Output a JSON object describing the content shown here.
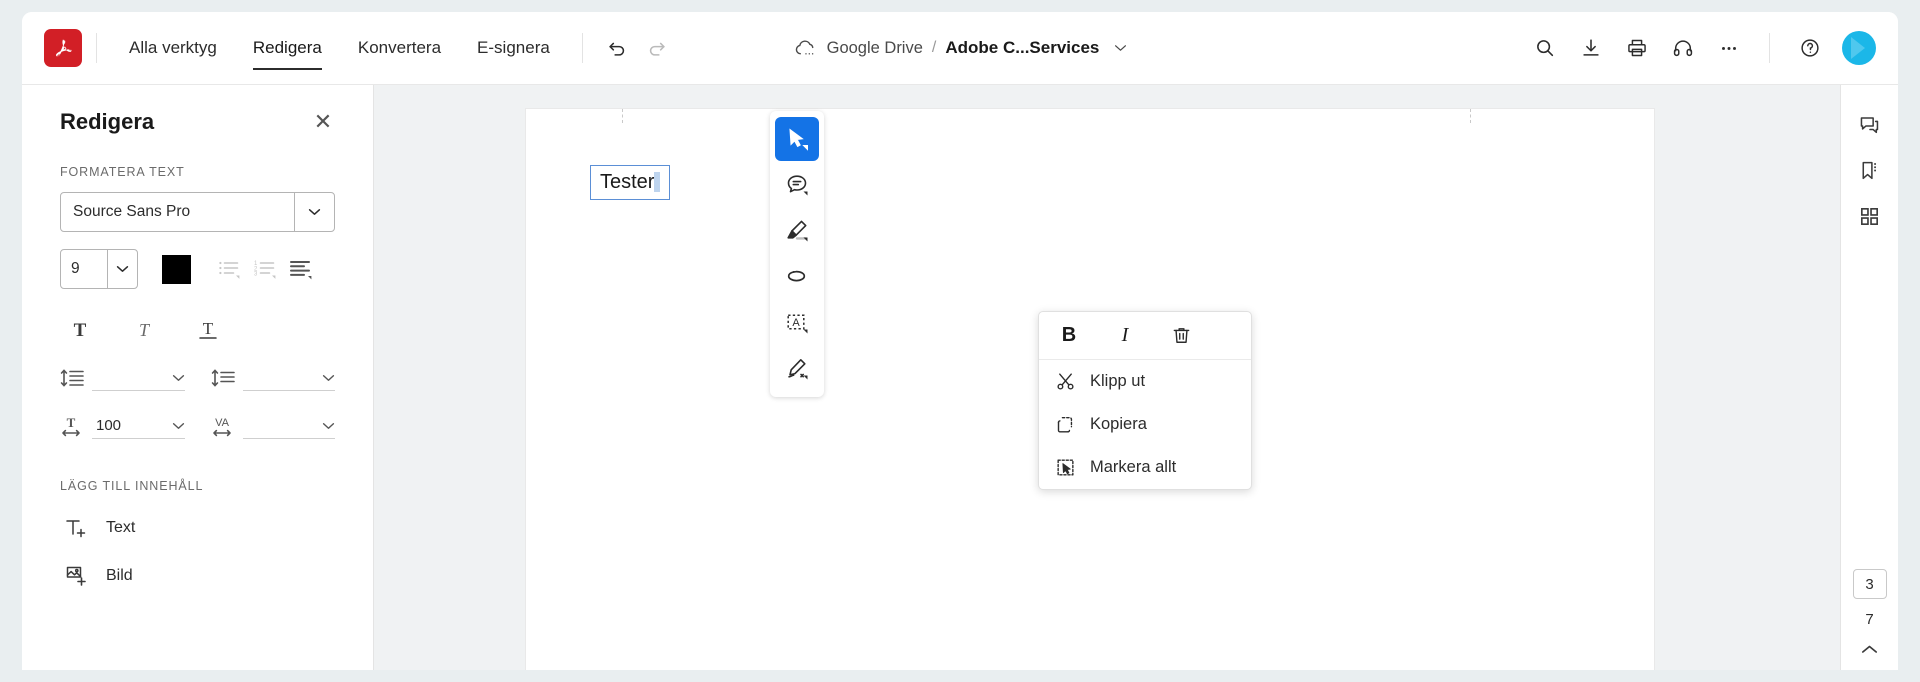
{
  "header": {
    "logo_icon": "adobe-acrobat-logo",
    "logo_color": "#d21f26",
    "tabs": [
      {
        "label": "Alla verktyg",
        "active": false
      },
      {
        "label": "Redigera",
        "active": true
      },
      {
        "label": "Konvertera",
        "active": false
      },
      {
        "label": "E-signera",
        "active": false
      }
    ],
    "undo_icon": "undo-icon",
    "redo_icon": "redo-icon",
    "redo_disabled": true,
    "storage_icon": "cloud-icon",
    "storage_name": "Google Drive",
    "separator": "/",
    "file_name": "Adobe C...Services",
    "file_menu_icon": "chevron-down-icon",
    "right_icons": [
      {
        "name": "search-icon"
      },
      {
        "name": "download-icon"
      },
      {
        "name": "print-icon"
      },
      {
        "name": "headphones-icon"
      },
      {
        "name": "more-options-icon"
      }
    ],
    "help_icon": "help-icon",
    "avatar_name": "avatar",
    "avatar_color": "#1bb7e8"
  },
  "left_panel": {
    "title": "Redigera",
    "close_icon": "close-icon",
    "format_section_label": "FORMATERA TEXT",
    "font": {
      "value": "Source Sans Pro",
      "dropdown_icon": "chevron-down-icon"
    },
    "font_size": {
      "value": "9",
      "dropdown_icon": "chevron-down-icon"
    },
    "color_swatch": "#000000",
    "list_buttons": [
      {
        "name": "bulleted-list-icon",
        "disabled": true
      },
      {
        "name": "numbered-list-icon",
        "disabled": true
      },
      {
        "name": "text-align-icon",
        "disabled": false
      }
    ],
    "style_buttons": [
      {
        "name": "bold-icon",
        "label": "T"
      },
      {
        "name": "italic-icon",
        "label": "T"
      },
      {
        "name": "underline-icon",
        "label": "T"
      }
    ],
    "spacing": [
      {
        "name": "line-spacing",
        "icon": "line-spacing-icon",
        "value": ""
      },
      {
        "name": "paragraph-spacing",
        "icon": "paragraph-spacing-icon",
        "value": ""
      },
      {
        "name": "horizontal-scale",
        "icon": "horizontal-scale-icon",
        "value": "100"
      },
      {
        "name": "tracking",
        "icon": "tracking-icon",
        "value": ""
      }
    ],
    "add_section_label": "LÄGG TILL INNEHÅLL",
    "add_items": [
      {
        "label": "Text",
        "icon": "add-text-icon"
      },
      {
        "label": "Bild",
        "icon": "add-image-icon"
      }
    ]
  },
  "tool_rail": {
    "tools": [
      {
        "name": "select-tool",
        "icon": "cursor-icon",
        "active": true
      },
      {
        "name": "comment-tool",
        "icon": "comment-icon",
        "active": false
      },
      {
        "name": "highlight-tool",
        "icon": "highlighter-icon",
        "active": false
      },
      {
        "name": "lasso-tool",
        "icon": "lasso-icon",
        "active": false
      },
      {
        "name": "textbox-tool",
        "icon": "text-box-icon",
        "active": false
      },
      {
        "name": "sign-tool",
        "icon": "signature-pen-icon",
        "active": false
      }
    ],
    "active_color": "#1473e6"
  },
  "canvas": {
    "text_box": {
      "value": "Tester",
      "border_color": "#5b8fd6",
      "selection_color": "#bed4ee"
    }
  },
  "context_menu": {
    "top_actions": [
      {
        "name": "bold-button",
        "label": "B",
        "icon": "bold-icon"
      },
      {
        "name": "italic-button",
        "label": "I",
        "icon": "italic-icon"
      },
      {
        "name": "delete-button",
        "label": "",
        "icon": "trash-icon"
      }
    ],
    "items": [
      {
        "label": "Klipp ut",
        "icon": "scissors-icon"
      },
      {
        "label": "Kopiera",
        "icon": "copy-icon"
      },
      {
        "label": "Markera allt",
        "icon": "select-all-icon"
      }
    ]
  },
  "right_rail": {
    "buttons": [
      {
        "name": "comments-panel",
        "icon": "comment-bubble-icon"
      },
      {
        "name": "bookmarks-panel",
        "icon": "bookmark-icon"
      },
      {
        "name": "thumbnails-panel",
        "icon": "grid-icon"
      }
    ],
    "current_page": "3",
    "total_pages": "7",
    "scroll_up_icon": "chevron-up-icon"
  }
}
